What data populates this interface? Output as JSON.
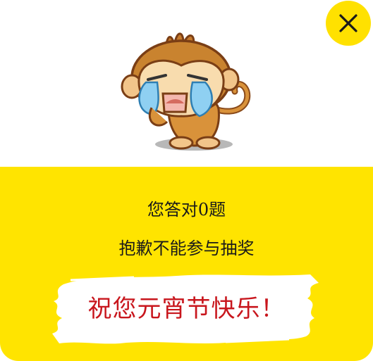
{
  "dialog": {
    "close_icon": "close-icon",
    "accent_color": "#ffe400",
    "greeting_color": "#c8161d"
  },
  "result": {
    "line1": "您答对0题",
    "line2": "抱歉不能参与抽奖"
  },
  "greeting": {
    "text": "祝您元宵节快乐！"
  },
  "illustration": {
    "name": "crying-monkey"
  }
}
